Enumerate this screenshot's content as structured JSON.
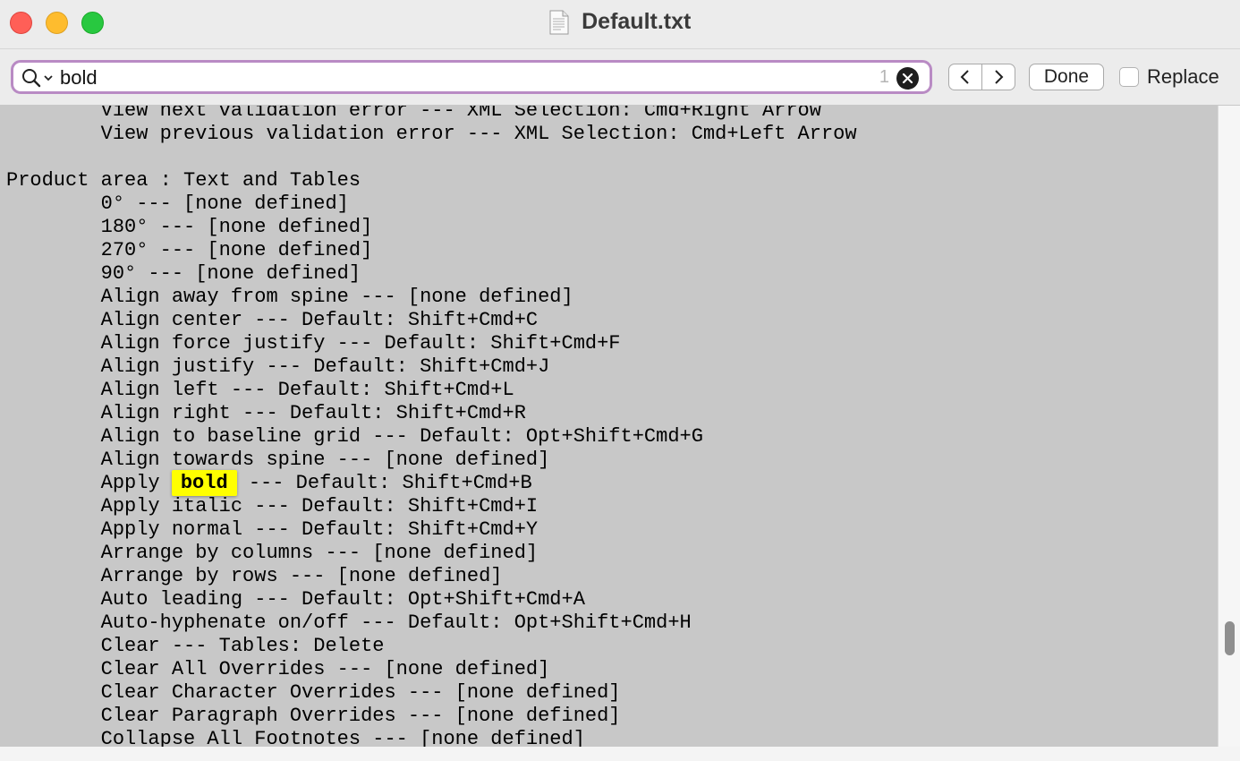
{
  "window": {
    "title": "Default.txt",
    "colors": {
      "close": "#ff5f57",
      "minimize": "#febc2e",
      "maximize": "#28c840"
    }
  },
  "find_bar": {
    "query": "bold",
    "match_count": "1",
    "done_label": "Done",
    "replace_label": "Replace",
    "replace_checked": false,
    "accent": "#b98bc4"
  },
  "editor": {
    "highlight": "bold",
    "highlight_color": "#ffff00",
    "lines": [
      "        View next validation error --- XML Selection: Cmd+Right Arrow",
      "        View previous validation error --- XML Selection: Cmd+Left Arrow",
      "",
      "Product area : Text and Tables",
      "        0° --- [none defined]",
      "        180° --- [none defined]",
      "        270° --- [none defined]",
      "        90° --- [none defined]",
      "        Align away from spine --- [none defined]",
      "        Align center --- Default: Shift+Cmd+C",
      "        Align force justify --- Default: Shift+Cmd+F",
      "        Align justify --- Default: Shift+Cmd+J",
      "        Align left --- Default: Shift+Cmd+L",
      "        Align right --- Default: Shift+Cmd+R",
      "        Align to baseline grid --- Default: Opt+Shift+Cmd+G",
      "        Align towards spine --- [none defined]",
      "        Apply bold --- Default: Shift+Cmd+B",
      "        Apply italic --- Default: Shift+Cmd+I",
      "        Apply normal --- Default: Shift+Cmd+Y",
      "        Arrange by columns --- [none defined]",
      "        Arrange by rows --- [none defined]",
      "        Auto leading --- Default: Opt+Shift+Cmd+A",
      "        Auto-hyphenate on/off --- Default: Opt+Shift+Cmd+H",
      "        Clear --- Tables: Delete",
      "        Clear All Overrides --- [none defined]",
      "        Clear Character Overrides --- [none defined]",
      "        Clear Paragraph Overrides --- [none defined]",
      "        Collapse All Footnotes --- [none defined]"
    ]
  }
}
